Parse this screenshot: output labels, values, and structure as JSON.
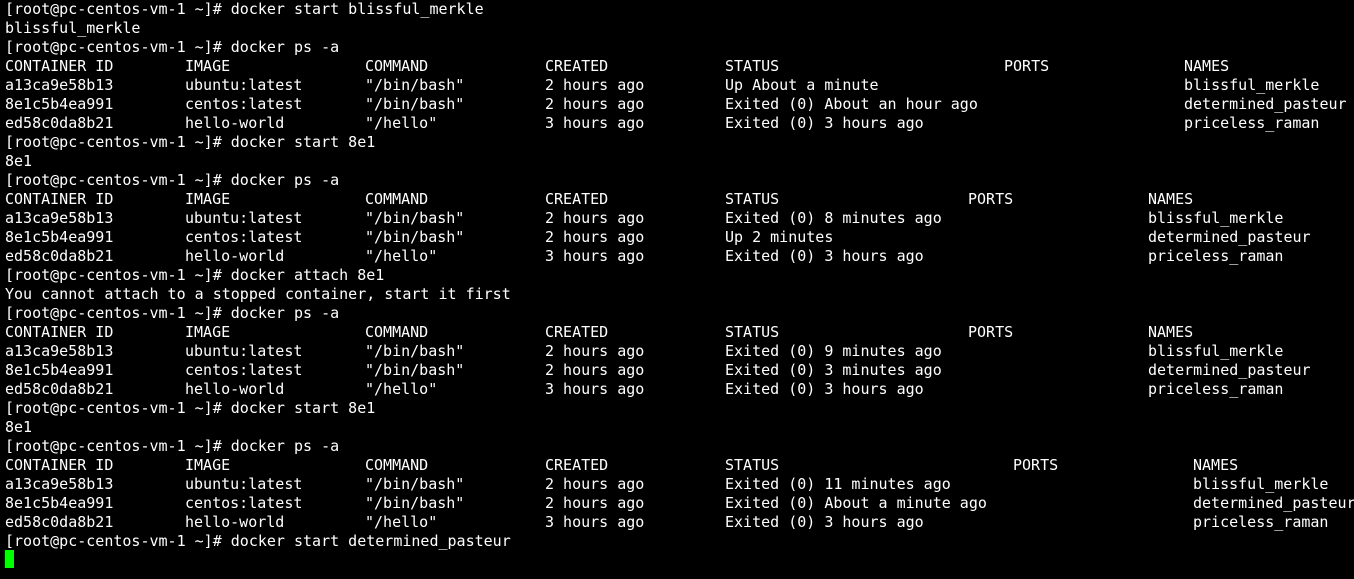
{
  "terminal": {
    "cursor_color": "#00ff00",
    "background": "#000000",
    "foreground": "#ffffff",
    "lines": [
      {
        "kind": "text",
        "text": "[root@pc-centos-vm-1 ~]# docker start blissful_merkle"
      },
      {
        "kind": "text",
        "text": "blissful_merkle"
      },
      {
        "kind": "text",
        "text": "[root@pc-centos-vm-1 ~]# docker ps -a"
      },
      {
        "kind": "row",
        "layout": 0,
        "cells": [
          "CONTAINER ID",
          "IMAGE",
          "COMMAND",
          "CREATED",
          "STATUS",
          "PORTS",
          "NAMES"
        ]
      },
      {
        "kind": "row",
        "layout": 0,
        "cells": [
          "a13ca9e58b13",
          "ubuntu:latest",
          "\"/bin/bash\"",
          "2 hours ago",
          "Up About a minute",
          "",
          "blissful_merkle"
        ]
      },
      {
        "kind": "row",
        "layout": 0,
        "cells": [
          "8e1c5b4ea991",
          "centos:latest",
          "\"/bin/bash\"",
          "2 hours ago",
          "Exited (0) About an hour ago",
          "",
          "determined_pasteur"
        ]
      },
      {
        "kind": "row",
        "layout": 0,
        "cells": [
          "ed58c0da8b21",
          "hello-world",
          "\"/hello\"",
          "3 hours ago",
          "Exited (0) 3 hours ago",
          "",
          "priceless_raman"
        ]
      },
      {
        "kind": "text",
        "text": "[root@pc-centos-vm-1 ~]# docker start 8e1"
      },
      {
        "kind": "text",
        "text": "8e1"
      },
      {
        "kind": "text",
        "text": "[root@pc-centos-vm-1 ~]# docker ps -a"
      },
      {
        "kind": "row",
        "layout": 1,
        "cells": [
          "CONTAINER ID",
          "IMAGE",
          "COMMAND",
          "CREATED",
          "STATUS",
          "PORTS",
          "NAMES"
        ]
      },
      {
        "kind": "row",
        "layout": 1,
        "cells": [
          "a13ca9e58b13",
          "ubuntu:latest",
          "\"/bin/bash\"",
          "2 hours ago",
          "Exited (0) 8 minutes ago",
          "",
          "blissful_merkle"
        ]
      },
      {
        "kind": "row",
        "layout": 1,
        "cells": [
          "8e1c5b4ea991",
          "centos:latest",
          "\"/bin/bash\"",
          "2 hours ago",
          "Up 2 minutes",
          "",
          "determined_pasteur"
        ]
      },
      {
        "kind": "row",
        "layout": 1,
        "cells": [
          "ed58c0da8b21",
          "hello-world",
          "\"/hello\"",
          "3 hours ago",
          "Exited (0) 3 hours ago",
          "",
          "priceless_raman"
        ]
      },
      {
        "kind": "text",
        "text": "[root@pc-centos-vm-1 ~]# docker attach 8e1"
      },
      {
        "kind": "text",
        "text": "You cannot attach to a stopped container, start it first"
      },
      {
        "kind": "text",
        "text": "[root@pc-centos-vm-1 ~]# docker ps -a"
      },
      {
        "kind": "row",
        "layout": 1,
        "cells": [
          "CONTAINER ID",
          "IMAGE",
          "COMMAND",
          "CREATED",
          "STATUS",
          "PORTS",
          "NAMES"
        ]
      },
      {
        "kind": "row",
        "layout": 1,
        "cells": [
          "a13ca9e58b13",
          "ubuntu:latest",
          "\"/bin/bash\"",
          "2 hours ago",
          "Exited (0) 9 minutes ago",
          "",
          "blissful_merkle"
        ]
      },
      {
        "kind": "row",
        "layout": 1,
        "cells": [
          "8e1c5b4ea991",
          "centos:latest",
          "\"/bin/bash\"",
          "2 hours ago",
          "Exited (0) 3 minutes ago",
          "",
          "determined_pasteur"
        ]
      },
      {
        "kind": "row",
        "layout": 1,
        "cells": [
          "ed58c0da8b21",
          "hello-world",
          "\"/hello\"",
          "3 hours ago",
          "Exited (0) 3 hours ago",
          "",
          "priceless_raman"
        ]
      },
      {
        "kind": "text",
        "text": "[root@pc-centos-vm-1 ~]# docker start 8e1"
      },
      {
        "kind": "text",
        "text": "8e1"
      },
      {
        "kind": "text",
        "text": "[root@pc-centos-vm-1 ~]# docker ps -a"
      },
      {
        "kind": "row",
        "layout": 2,
        "cells": [
          "CONTAINER ID",
          "IMAGE",
          "COMMAND",
          "CREATED",
          "STATUS",
          "PORTS",
          "NAMES"
        ]
      },
      {
        "kind": "row",
        "layout": 2,
        "cells": [
          "a13ca9e58b13",
          "ubuntu:latest",
          "\"/bin/bash\"",
          "2 hours ago",
          "Exited (0) 11 minutes ago",
          "",
          "blissful_merkle"
        ]
      },
      {
        "kind": "row",
        "layout": 2,
        "cells": [
          "8e1c5b4ea991",
          "centos:latest",
          "\"/bin/bash\"",
          "2 hours ago",
          "Exited (0) About a minute ago",
          "",
          "determined_pasteur"
        ]
      },
      {
        "kind": "row",
        "layout": 2,
        "cells": [
          "ed58c0da8b21",
          "hello-world",
          "\"/hello\"",
          "3 hours ago",
          "Exited (0) 3 hours ago",
          "",
          "priceless_raman"
        ]
      },
      {
        "kind": "text",
        "text": "[root@pc-centos-vm-1 ~]# docker start determined_pasteur"
      }
    ]
  }
}
